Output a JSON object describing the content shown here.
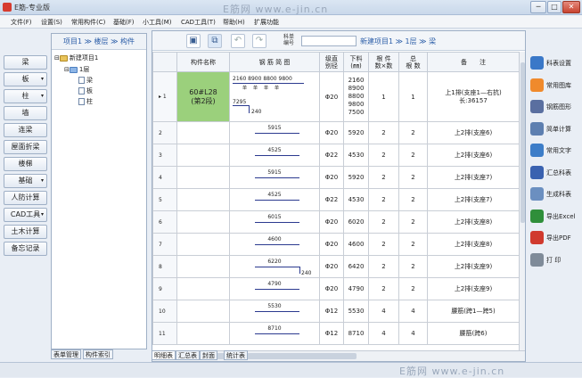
{
  "window": {
    "title": "E筋-专业版",
    "min": "─",
    "max": "□",
    "close": "✕"
  },
  "watermark_top": "E筋网 www.e-jin.cn",
  "watermark_bottom": "E筋网 www.e-jin.cn",
  "menu": [
    "文件(F)",
    "设置(S)",
    "常用构件(C)",
    "基础(F)",
    "小工具(M)",
    "CAD工具(T)",
    "帮助(H)",
    "扩展功能"
  ],
  "left_buttons": [
    {
      "label": "梁",
      "dropdown": false
    },
    {
      "label": "板",
      "dropdown": true
    },
    {
      "label": "柱",
      "dropdown": true
    },
    {
      "label": "墙",
      "dropdown": false
    },
    {
      "label": "连梁",
      "dropdown": false
    },
    {
      "label": "屋面折梁",
      "dropdown": false
    },
    {
      "label": "楼梯",
      "dropdown": false
    },
    {
      "label": "基础",
      "dropdown": true
    },
    {
      "label": "人防计算",
      "dropdown": false
    },
    {
      "label": "CAD工具",
      "dropdown": true
    },
    {
      "label": "土木计算",
      "dropdown": false
    },
    {
      "label": "备忘记录",
      "dropdown": false
    }
  ],
  "tree": {
    "header": "项目1 ≫ 楼层 ≫ 构件",
    "root": "新建项目1",
    "floor": "1层",
    "items": [
      "梁",
      "板",
      "柱"
    ]
  },
  "left_tabs": [
    "表单管理",
    "构件索引"
  ],
  "toolbar": {
    "label": "科单\n编号",
    "input_value": "",
    "breadcrumb": "新建项目1 ≫ 1层 ≫ 梁"
  },
  "table": {
    "headers": [
      "构件名称",
      "钢 筋 简 图",
      "级直\n别径",
      "下料\n(㎜)",
      "根 件\n数×数",
      "总\n根 数",
      "备　　注"
    ],
    "rows": [
      {
        "no": "▸ 1",
        "name": "60#L28\n(第2段)",
        "sketch_top": "2160 8900 8800 9800",
        "sketch_sub": "单　单　单　单",
        "sketch_hook": "7295",
        "sketch_tail": "240",
        "grade": "Φ20",
        "length": "2160\n8900\n8800\n9800\n7500",
        "count": "1",
        "total": "1",
        "note": "上1排(支座1—右抗)\n长:36157"
      },
      {
        "no": "2",
        "name": "",
        "sketch_top": "5915",
        "sketch_tail": "",
        "grade": "Φ20",
        "length": "5920",
        "count": "2",
        "total": "2",
        "note": "上2排(支座6)"
      },
      {
        "no": "3",
        "name": "",
        "sketch_top": "4525",
        "sketch_tail": "",
        "grade": "Φ22",
        "length": "4530",
        "count": "2",
        "total": "2",
        "note": "上2排(支座6)"
      },
      {
        "no": "4",
        "name": "",
        "sketch_top": "5915",
        "sketch_tail": "",
        "grade": "Φ20",
        "length": "5920",
        "count": "2",
        "total": "2",
        "note": "上2排(支座7)"
      },
      {
        "no": "5",
        "name": "",
        "sketch_top": "4525",
        "sketch_tail": "",
        "grade": "Φ22",
        "length": "4530",
        "count": "2",
        "total": "2",
        "note": "上2排(支座7)"
      },
      {
        "no": "6",
        "name": "",
        "sketch_top": "6015",
        "sketch_tail": "",
        "grade": "Φ20",
        "length": "6020",
        "count": "2",
        "total": "2",
        "note": "上2排(支座8)"
      },
      {
        "no": "7",
        "name": "",
        "sketch_top": "4600",
        "sketch_tail": "",
        "grade": "Φ20",
        "length": "4600",
        "count": "2",
        "total": "2",
        "note": "上2排(支座8)"
      },
      {
        "no": "8",
        "name": "",
        "sketch_top": "6220",
        "sketch_tail": "240",
        "grade": "Φ20",
        "length": "6420",
        "count": "2",
        "total": "2",
        "note": "上2排(支座9)"
      },
      {
        "no": "9",
        "name": "",
        "sketch_top": "4790",
        "sketch_tail": "",
        "grade": "Φ20",
        "length": "4790",
        "count": "2",
        "total": "2",
        "note": "上2排(支座9)"
      },
      {
        "no": "10",
        "name": "",
        "sketch_top": "5530",
        "sketch_tail": "",
        "grade": "Φ12",
        "length": "5530",
        "count": "4",
        "total": "4",
        "note": "腰筋(跨1—跨5)"
      },
      {
        "no": "11",
        "name": "",
        "sketch_top": "8710",
        "sketch_tail": "",
        "grade": "Φ12",
        "length": "8710",
        "count": "4",
        "total": "4",
        "note": "腰筋(跨6)"
      }
    ]
  },
  "bottom_tabs": [
    "明细表",
    "汇总表",
    "封面",
    "统计表"
  ],
  "right_tools": [
    {
      "label": "科表设置",
      "icon": "gear-icon",
      "color": "#3a78c8"
    },
    {
      "label": "常用图库",
      "icon": "folder-icon",
      "color": "#f08a2c"
    },
    {
      "label": "钢筋图形",
      "icon": "shape-icon",
      "color": "#5a6fa0"
    },
    {
      "label": "简单计算",
      "icon": "calculator-icon",
      "color": "#5d7fb0"
    },
    {
      "label": "常用文字",
      "icon": "text-icon",
      "color": "#3d7dc8"
    },
    {
      "label": "汇总科表",
      "icon": "sum-icon",
      "color": "#3a62b0"
    },
    {
      "label": "生成科表",
      "icon": "table-icon",
      "color": "#6b8fc0"
    },
    {
      "label": "导出Excel",
      "icon": "excel-icon",
      "color": "#2f8f3a"
    },
    {
      "label": "导出PDF",
      "icon": "pdf-icon",
      "color": "#d03a2e"
    },
    {
      "label": "打 印",
      "icon": "printer-icon",
      "color": "#7f8b99"
    }
  ]
}
